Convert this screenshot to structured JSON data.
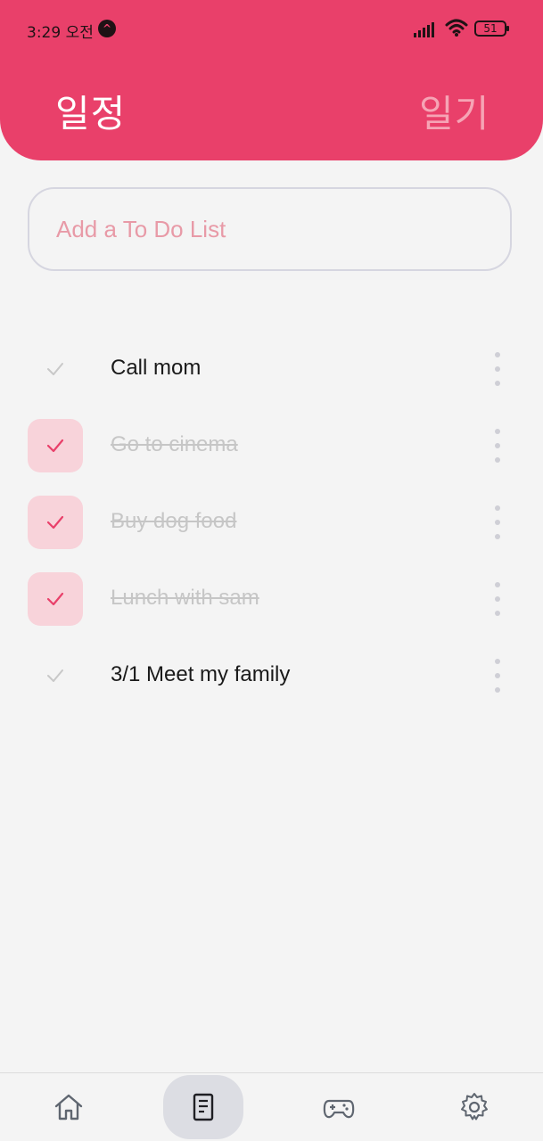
{
  "status_bar": {
    "time": "3:29 오전",
    "app_icon_glyph": "^",
    "battery_level": "51"
  },
  "header": {
    "tabs": [
      {
        "label": "일정",
        "active": true
      },
      {
        "label": "일기",
        "active": false
      }
    ]
  },
  "todo_input": {
    "placeholder": "Add a To Do List",
    "value": ""
  },
  "todos": [
    {
      "text": "Call mom",
      "done": false
    },
    {
      "text": "Go to cinema",
      "done": true
    },
    {
      "text": "Buy dog food",
      "done": true
    },
    {
      "text": "Lunch with sam",
      "done": true
    },
    {
      "text": "3/1 Meet my family",
      "done": false
    }
  ],
  "bottom_nav": {
    "items": [
      {
        "icon": "home-icon",
        "active": false
      },
      {
        "icon": "notes-icon",
        "active": true
      },
      {
        "icon": "gamepad-icon",
        "active": false
      },
      {
        "icon": "gear-icon",
        "active": false
      }
    ]
  },
  "colors": {
    "accent": "#e9406a",
    "accent_light": "#f8d3da",
    "inactive_tab": "#f6a4b5",
    "placeholder": "#e89aa7",
    "background": "#f4f4f4"
  }
}
